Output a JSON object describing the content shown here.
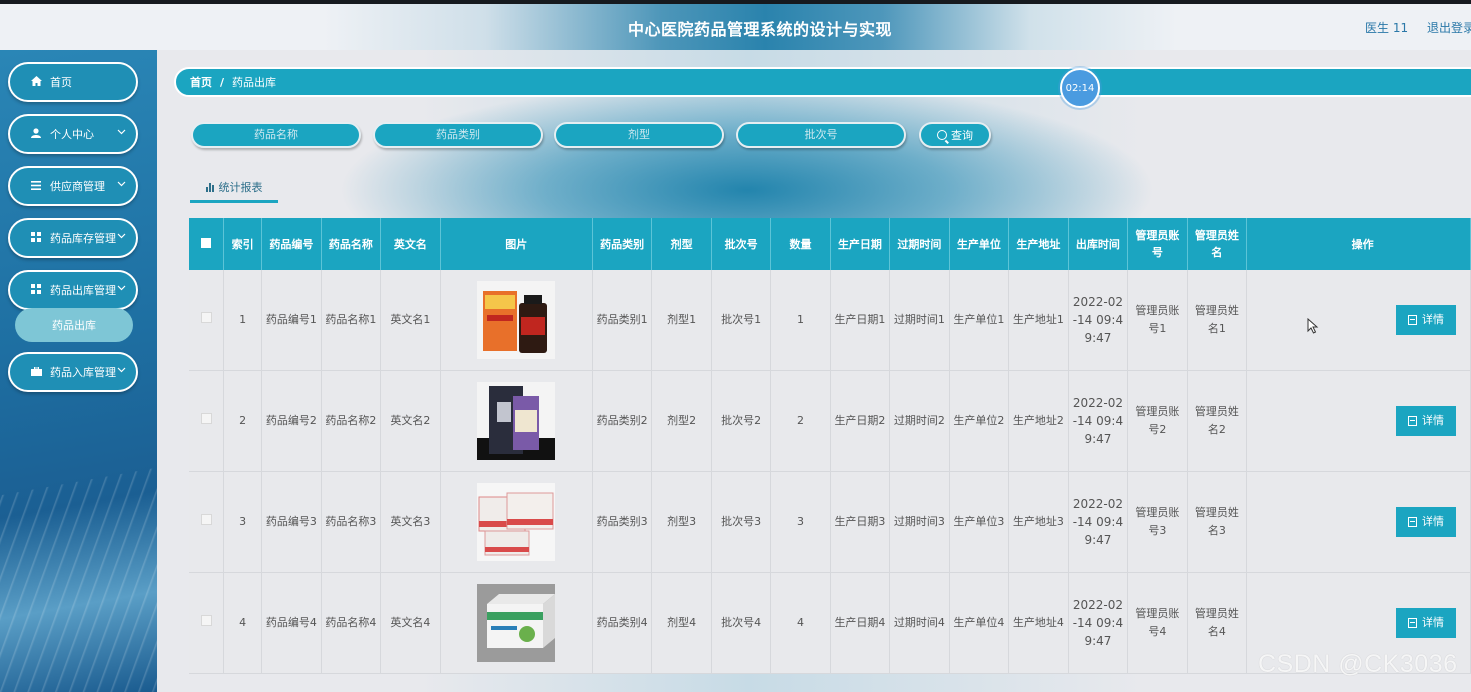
{
  "header": {
    "title": "中心医院药品管理系统的设计与实现",
    "user": "医生 11",
    "logout": "退出登录"
  },
  "sidebar": {
    "items": [
      {
        "label": "首页",
        "icon": "home-icon"
      },
      {
        "label": "个人中心",
        "icon": "user-icon"
      },
      {
        "label": "供应商管理",
        "icon": "list-icon"
      },
      {
        "label": "药品库存管理",
        "icon": "grid-icon"
      },
      {
        "label": "药品出库管理",
        "icon": "grid-icon"
      },
      {
        "label": "药品入库管理",
        "icon": "briefcase-icon"
      }
    ],
    "submenu_active": "药品出库"
  },
  "breadcrumb": {
    "home": "首页",
    "sep": "/",
    "current": "药品出库"
  },
  "timer": "02:14",
  "search": {
    "fields": [
      "药品名称",
      "药品类别",
      "剂型",
      "批次号"
    ],
    "button": "查询"
  },
  "report_tab": "统计报表",
  "table": {
    "columns": [
      "索引",
      "药品编号",
      "药品名称",
      "英文名",
      "图片",
      "药品类别",
      "剂型",
      "批次号",
      "数量",
      "生产日期",
      "过期时间",
      "生产单位",
      "生产地址",
      "出库时间",
      "管理员账号",
      "管理员姓名",
      "操作"
    ],
    "rows": [
      {
        "index": "1",
        "code": "药品编号1",
        "name": "药品名称1",
        "en": "英文名1",
        "category": "药品类别1",
        "form": "剂型1",
        "batch": "批次号1",
        "qty": "1",
        "prod_date": "生产日期1",
        "expire": "过期时间1",
        "unit": "生产单位1",
        "addr": "生产地址1",
        "out_time": "2022-02-14 09:49:47",
        "admin_acc": "管理员账号1",
        "admin_name": "管理员姓名1",
        "action": "详情"
      },
      {
        "index": "2",
        "code": "药品编号2",
        "name": "药品名称2",
        "en": "英文名2",
        "category": "药品类别2",
        "form": "剂型2",
        "batch": "批次号2",
        "qty": "2",
        "prod_date": "生产日期2",
        "expire": "过期时间2",
        "unit": "生产单位2",
        "addr": "生产地址2",
        "out_time": "2022-02-14 09:49:47",
        "admin_acc": "管理员账号2",
        "admin_name": "管理员姓名2",
        "action": "详情"
      },
      {
        "index": "3",
        "code": "药品编号3",
        "name": "药品名称3",
        "en": "英文名3",
        "category": "药品类别3",
        "form": "剂型3",
        "batch": "批次号3",
        "qty": "3",
        "prod_date": "生产日期3",
        "expire": "过期时间3",
        "unit": "生产单位3",
        "addr": "生产地址3",
        "out_time": "2022-02-14 09:49:47",
        "admin_acc": "管理员账号3",
        "admin_name": "管理员姓名3",
        "action": "详情"
      },
      {
        "index": "4",
        "code": "药品编号4",
        "name": "药品名称4",
        "en": "英文名4",
        "category": "药品类别4",
        "form": "剂型4",
        "batch": "批次号4",
        "qty": "4",
        "prod_date": "生产日期4",
        "expire": "过期时间4",
        "unit": "生产单位4",
        "addr": "生产地址4",
        "out_time": "2022-02-14 09:49:47",
        "admin_acc": "管理员账号4",
        "admin_name": "管理员姓名4",
        "action": "详情"
      }
    ]
  },
  "watermark": "CSDN @CK3036",
  "colors": {
    "accent": "#1ba5c1",
    "sidebar": "#1e6fa2",
    "header_link": "#2a78a8"
  }
}
